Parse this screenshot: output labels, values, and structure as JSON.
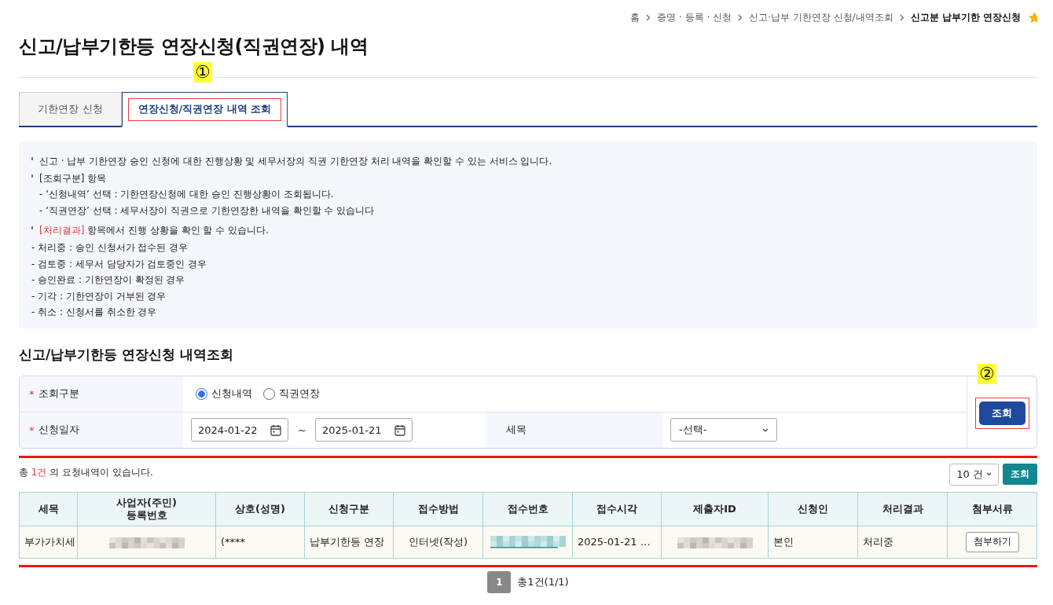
{
  "breadcrumb": [
    {
      "label": "홈",
      "current": false
    },
    {
      "label": "증명 · 등록 · 신청",
      "current": false
    },
    {
      "label": "신고·납부 기한연장 신청/내역조회",
      "current": false
    },
    {
      "label": "신고분 납부기한 연장신청",
      "current": true
    }
  ],
  "favorite": true,
  "page_title": "신고/납부기한등 연장신청(직권연장) 내역",
  "tabs": [
    {
      "label": "기한연장 신청",
      "selected": false,
      "highlighted": false
    },
    {
      "label": "연장신청/직권연장 내역 조회",
      "selected": true,
      "highlighted": true
    }
  ],
  "annotations": [
    {
      "label": "①"
    },
    {
      "label": "②"
    }
  ],
  "info": [
    {
      "kind": "bullet",
      "parts": [
        {
          "text": "신고 · 납부 기한연장 승인 신청에 대한 진행상황 및 세무서장의 직권 기한연장 처리 내역을 확인할 수 있는 서비스 입니다.",
          "emphasis": false
        }
      ]
    },
    {
      "kind": "bullet",
      "parts": [
        {
          "text": "[조회구분] 항목",
          "emphasis": false
        }
      ]
    },
    {
      "kind": "sub",
      "parts": [
        {
          "text": "- ‘신청내역’ 선택 : 기한연장신청에 대한 승인 진행상황이 조회됩니다.",
          "emphasis": false
        }
      ]
    },
    {
      "kind": "sub",
      "parts": [
        {
          "text": "- ‘직권연장’ 선택 : 세무서장이 직권으로 기한연장한 내역을 확인할 수 있습니다",
          "emphasis": false
        }
      ]
    },
    {
      "kind": "bullet",
      "parts": [
        {
          "text": "[처리결과]",
          "emphasis": true
        },
        {
          "text": " 항목에서 진행 상황을 확인 할 수 있습니다.",
          "emphasis": false
        }
      ]
    },
    {
      "kind": "plain",
      "parts": [
        {
          "text": "- 처리중 : 승인 신청서가 접수된 경우",
          "emphasis": false
        }
      ]
    },
    {
      "kind": "plain",
      "parts": [
        {
          "text": "- 검토중 : 세무서 담당자가 검토중인 경우",
          "emphasis": false
        }
      ]
    },
    {
      "kind": "plain",
      "parts": [
        {
          "text": "- 승인완료 : 기한연장이 확정된 경우",
          "emphasis": false
        }
      ]
    },
    {
      "kind": "plain",
      "parts": [
        {
          "text": "- 기각 : 기한연장이 거부된 경우",
          "emphasis": false
        }
      ]
    },
    {
      "kind": "plain",
      "parts": [
        {
          "text": "- 취소 : 신청서를 취소한 경우",
          "emphasis": false
        }
      ]
    }
  ],
  "section_title": "신고/납부기한등 연장신청 내역조회",
  "search_form": {
    "type_label": "조회구분",
    "type_mark": "*",
    "type_options": [
      {
        "label": "신청내역",
        "selected": true
      },
      {
        "label": "직권연장",
        "selected": false
      }
    ],
    "date_label": "신청일자",
    "date_mark": "*",
    "date_from": "2024-01-22",
    "date_separator": "~",
    "date_to": "2025-01-21",
    "tax_label": "세목",
    "tax_value": "-선택-",
    "search_button": {
      "label": "조회",
      "highlighted": true
    }
  },
  "results": {
    "highlighted": true,
    "summary": [
      {
        "text": "총 ",
        "emphasis": false
      },
      {
        "text": "1건",
        "emphasis": true
      },
      {
        "text": " 의 요청내역이 있습니다.",
        "emphasis": false
      }
    ],
    "page_size": "10 건",
    "refresh_button": "조회",
    "columns": [
      "세목",
      "사업자(주민)\n등록번호",
      "상호(성명)",
      "신청구분",
      "접수방법",
      "접수번호",
      "접수시각",
      "제출자ID",
      "신청인",
      "처리결과",
      "첨부서류"
    ],
    "rows": [
      [
        {
          "kind": "text",
          "text": "부가가치세"
        },
        {
          "kind": "redacted"
        },
        {
          "kind": "text",
          "text": "(****"
        },
        {
          "kind": "text",
          "text": "납부기한등 연장"
        },
        {
          "kind": "text",
          "text": "인터넷(작성)"
        },
        {
          "kind": "redacted-link"
        },
        {
          "kind": "text",
          "text": "2025-01-21 …"
        },
        {
          "kind": "redacted"
        },
        {
          "kind": "text",
          "text": "본인"
        },
        {
          "kind": "text",
          "text": "처리중"
        },
        {
          "kind": "button",
          "text": "첨부하기"
        }
      ]
    ]
  },
  "pagination": {
    "pages": [
      {
        "label": "1",
        "selected": true
      }
    ],
    "summary": "총1건(1/1)"
  }
}
